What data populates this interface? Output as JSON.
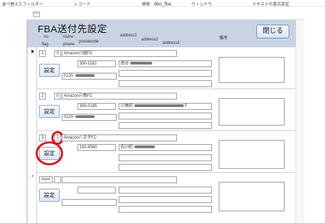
{
  "ribbon": {
    "items": [
      "並べ替えとフィルター",
      "レコード",
      "検索",
      "ウィンドウ",
      "テキストの書式設定"
    ]
  },
  "window": {
    "title": "dbo_fba"
  },
  "header": {
    "title": "FBA送付先設定",
    "close_label": "閉じる",
    "columns": {
      "no": "no",
      "flag": "flag",
      "name": "name",
      "phone": "phone",
      "postalcode": "postalcode",
      "address1": "address1",
      "address2": "address2",
      "address3": "address3",
      "remarks": "備考"
    }
  },
  "records": [
    {
      "no": "1",
      "flag": "0",
      "name": "Amazon川越FC",
      "postalcode": "350-1182",
      "phone": "0120-",
      "address1": "南台",
      "settings_label": "設定"
    },
    {
      "no": "2",
      "flag": "0",
      "name": "Amazon川島FC",
      "postalcode": "350-0195",
      "phone": "0120-",
      "address1": "川島町",
      "address1_suffix": "F",
      "settings_label": "設定"
    },
    {
      "no": "3",
      "flag": "1",
      "name": "Amazon八王子FC",
      "postalcode": "192-8560",
      "phone": "0120-",
      "address1": "石川町",
      "settings_label": "設定"
    }
  ],
  "new_record": {
    "no": "####",
    "settings_label": "設定",
    "marker": "*"
  },
  "colors": {
    "header_bg": "#c9d3e3",
    "button_border": "#87a6d4",
    "highlight_circle": "#e0101a"
  }
}
